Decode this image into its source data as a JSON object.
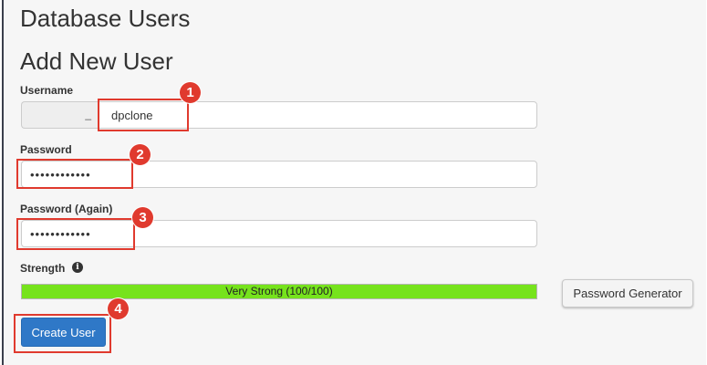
{
  "header": {
    "title": "Database Users",
    "subtitle": "Add New User"
  },
  "form": {
    "username_label": "Username",
    "username_prefix_separator": "_",
    "username_value": "dpclone",
    "password_label": "Password",
    "password_value": "••••••••••••",
    "password_again_label": "Password (Again)",
    "password_again_value": "••••••••••••",
    "strength_label": "Strength",
    "info_icon": "info-circle-icon",
    "strength_text": "Very Strong (100/100)",
    "strength_percent": 100,
    "generator_label": "Password Generator",
    "create_label": "Create User"
  },
  "annotations": {
    "badges": [
      "1",
      "2",
      "3",
      "4"
    ],
    "color": "#e03a2e"
  },
  "colors": {
    "strength_fill": "#76e31c",
    "primary_button": "#2f78c7"
  }
}
